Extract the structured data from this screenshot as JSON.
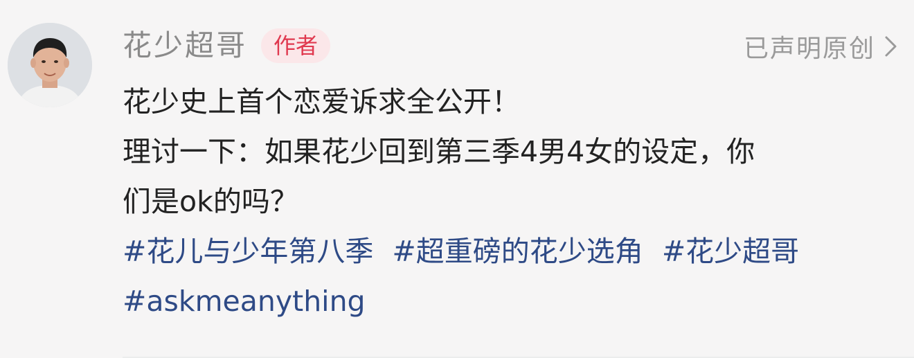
{
  "author": {
    "name": "花少超哥",
    "badge": "作者",
    "avatar_icon": "person-avatar-icon"
  },
  "header": {
    "original_label": "已声明原创",
    "chevron_icon": "chevron-right-icon"
  },
  "post": {
    "lines": [
      "花少史上首个恋爱诉求全公开！",
      "理讨一下：如果花少回到第三季4男4女的设定，你",
      "们是ok的吗？"
    ],
    "hashtags_line1": [
      "#花儿与少年第八季",
      "#超重磅的花少选角",
      "#花少超哥"
    ],
    "hashtags_line2": [
      "#askmeanything"
    ]
  },
  "colors": {
    "background": "#f6f5f5",
    "text": "#222222",
    "hashtag": "#2e4a86",
    "badge_text": "#e0394f",
    "badge_bg": "#fbe7e9",
    "muted": "#8a8a8a"
  }
}
